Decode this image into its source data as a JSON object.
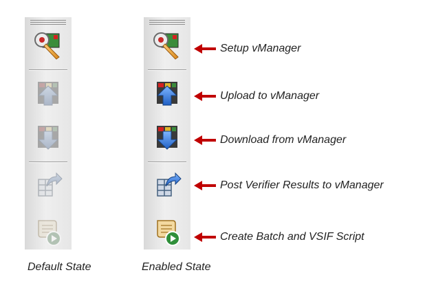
{
  "toolbars": [
    {
      "state_label": "Default State",
      "enabled": false
    },
    {
      "state_label": "Enabled State",
      "enabled": true
    }
  ],
  "buttons": [
    {
      "icon": "wrench-setup-icon",
      "label": "Setup vManager"
    },
    {
      "icon": "upload-arrow-icon",
      "label": "Upload to vManager"
    },
    {
      "icon": "download-arrow-icon",
      "label": "Download from vManager"
    },
    {
      "icon": "post-results-icon",
      "label": "Post Verifier Results to vManager"
    },
    {
      "icon": "batch-script-icon",
      "label": "Create Batch and VSIF Script"
    }
  ],
  "colors": {
    "arrow": "#c00000",
    "toolbar_bg": "#e6e6e6",
    "text": "#222222"
  }
}
